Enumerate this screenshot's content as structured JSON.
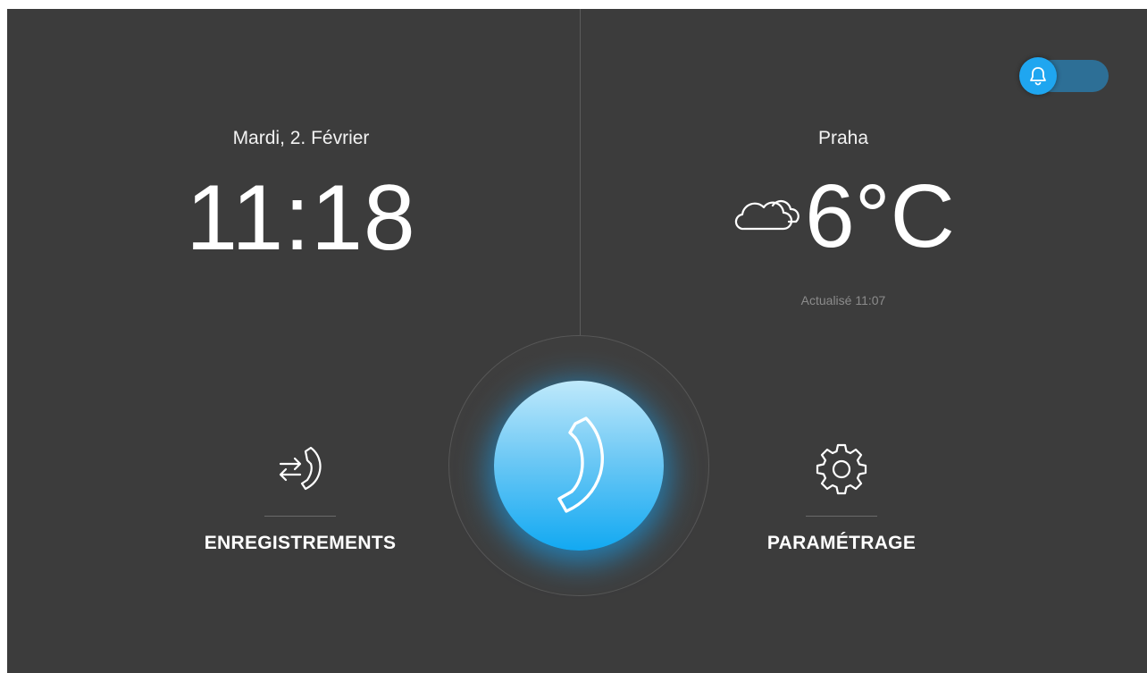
{
  "clock": {
    "date": "Mardi, 2. Février",
    "time": "11:18"
  },
  "weather": {
    "city": "Praha",
    "icon": "cloud-icon",
    "temperature": "6°C",
    "updated": "Actualisé 11:07"
  },
  "notifications_toggle": {
    "icon": "bell-icon",
    "state": "on"
  },
  "actions": {
    "records": {
      "label": "ENREGISTREMENTS",
      "icon": "call-log-icon"
    },
    "call": {
      "icon": "phone-handset-icon"
    },
    "settings": {
      "label": "PARAMÉTRAGE",
      "icon": "gear-icon"
    }
  },
  "colors": {
    "background": "#3c3c3c",
    "accent": "#1fa6f0",
    "text": "#ffffff",
    "muted_text": "#8c8c8c"
  }
}
